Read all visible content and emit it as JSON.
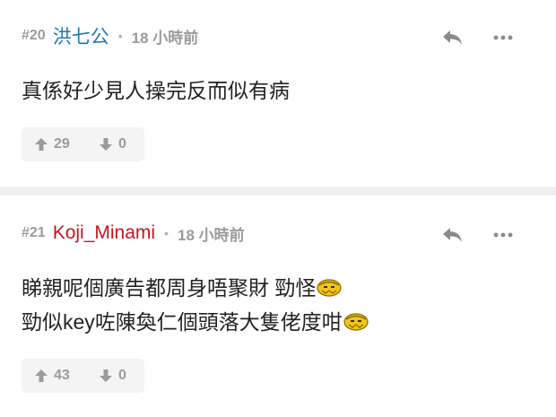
{
  "comments": [
    {
      "number": "#20",
      "username": "洪七公",
      "separator": "•",
      "time": "18 小時前",
      "line1": "真係好少見人操完反而似有病",
      "upvotes": "29",
      "downvotes": "0",
      "username_color": "#1e78b4"
    },
    {
      "number": "#21",
      "username": "Koji_Minami",
      "separator": "•",
      "time": "18 小時前",
      "line1": "睇親呢個廣告都周身唔聚財 勁怪",
      "line2": "勁似key咗陳奐仁個頭落大隻佬度咁",
      "upvotes": "43",
      "downvotes": "0",
      "username_color": "#c8141e"
    }
  ],
  "icons": {
    "reply": "reply-icon",
    "more": "more-icon",
    "upvote": "arrow-up-icon",
    "downvote": "arrow-down-icon",
    "emoji": "bow-emoji-icon"
  }
}
